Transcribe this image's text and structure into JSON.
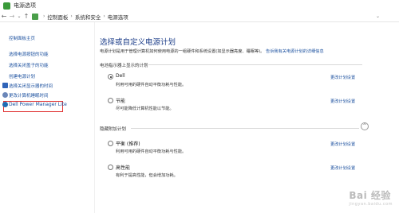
{
  "window": {
    "title": "电源选项"
  },
  "address": {
    "back": "←",
    "forward": "→",
    "dropdown": "⌄",
    "up": "↑",
    "crumbs": [
      "控制面板",
      "系统和安全",
      "电源选项"
    ],
    "sep": "›",
    "recent": "⌄"
  },
  "sidebar": {
    "items": [
      {
        "label": "控制面板主页"
      },
      {
        "label": "选择电源按钮的功能"
      },
      {
        "label": "选择关闭盖子的功能"
      },
      {
        "label": "创建电源计划"
      },
      {
        "label": "选择关闭显示器的时间"
      },
      {
        "label": "更改计算机睡眠时间"
      },
      {
        "label": "Dell Power Manager Lite"
      }
    ]
  },
  "main": {
    "title": "选择或自定义电源计划",
    "desc": "电源计划是用于管理计算机如何使用电源的一组硬件和系统设置(如显示器亮度、睡眠等)。",
    "desc_link": "告诉我有关电源计划的详细信息",
    "group1": "电池指示器上显示的计划",
    "group2": "隐藏附加计划",
    "collapse": "^",
    "change_link": "更改计划设置",
    "plans": [
      {
        "name": "Dell",
        "desc": "利用可用的硬件自动平衡功耗与性能。",
        "checked": true
      },
      {
        "name": "节能",
        "desc": "尽可能降低计算机性能以节能。",
        "checked": false
      },
      {
        "name": "平衡 (推荐)",
        "desc": "利用可用的硬件自动平衡功耗与性能。",
        "checked": false
      },
      {
        "name": "高性能",
        "desc": "有利于提高性能，但会增加功耗。",
        "checked": false
      }
    ]
  },
  "watermark": {
    "main": "Bai 经验",
    "sub": "jingyan.baidu.com"
  }
}
